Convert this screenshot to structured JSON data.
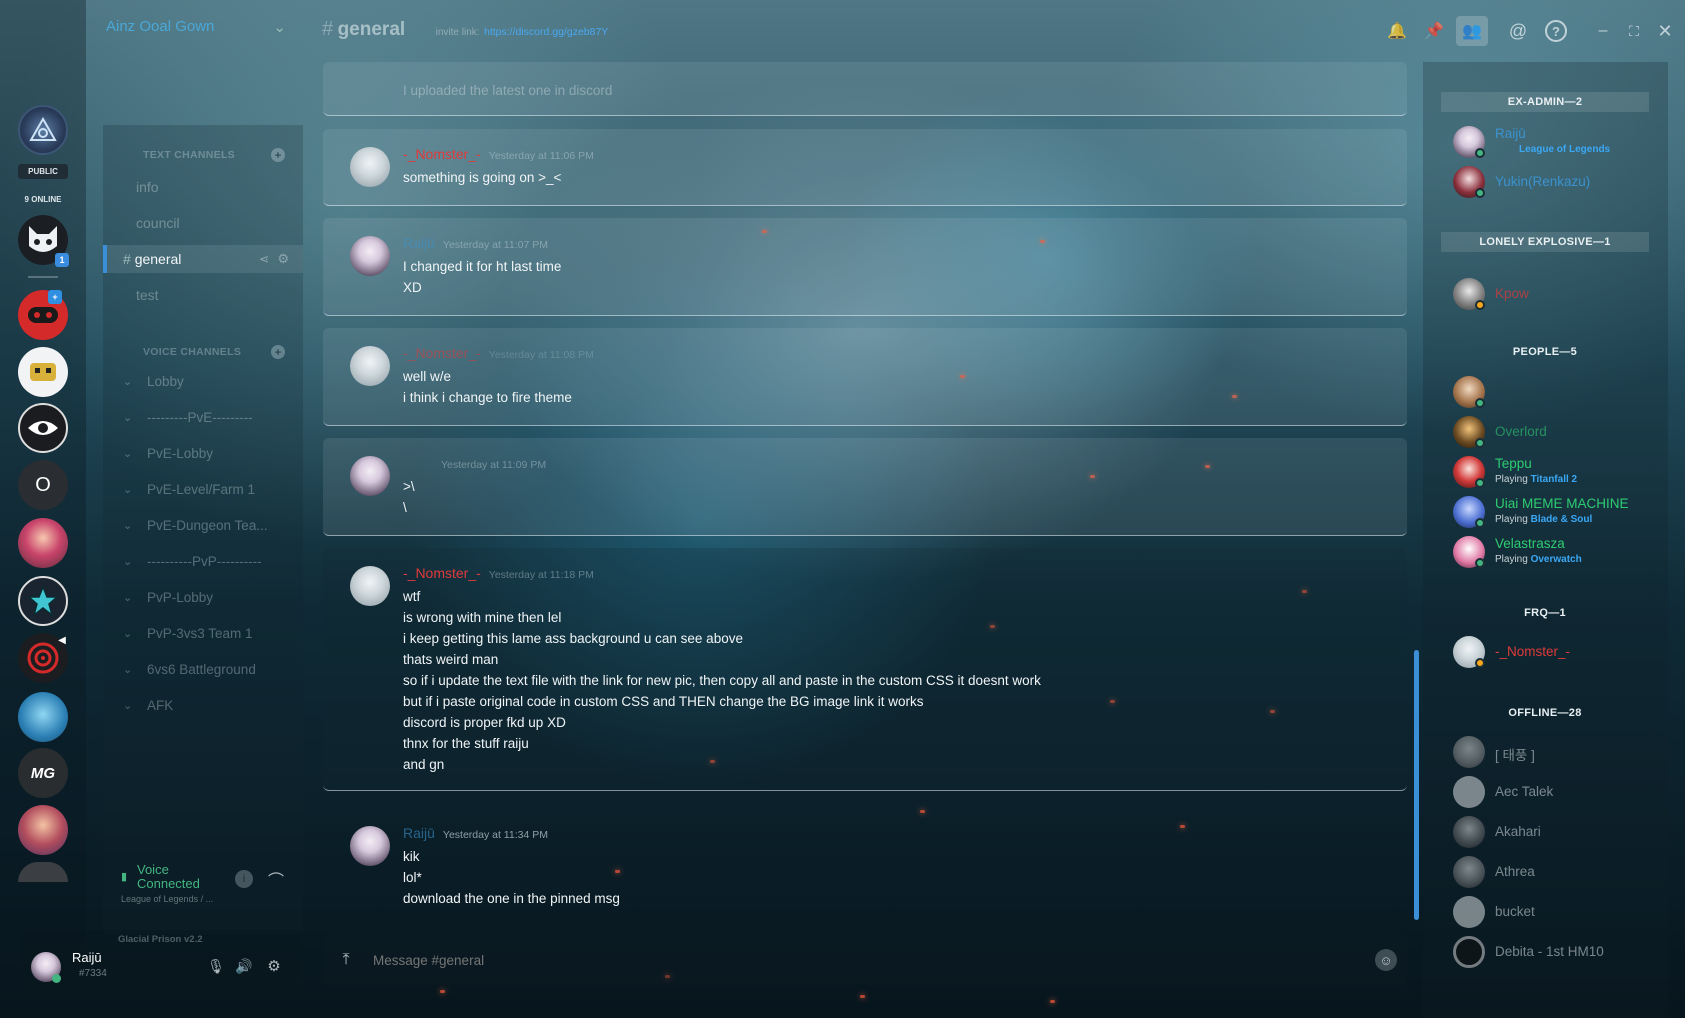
{
  "servers": {
    "public_tag": "PUBLIC",
    "online_tag": "9 ONLINE",
    "mention_count": "1",
    "o_label": "O",
    "mg_label": "MG"
  },
  "server_header": {
    "name": "Ainz Ooal Gown"
  },
  "channel_header": {
    "hash": "#",
    "name": "general",
    "invite_label": "invite link:",
    "invite_url": "https://discord.gg/gzeb87Y"
  },
  "text_channels": {
    "title": "TEXT CHANNELS",
    "items": [
      "info",
      "council",
      "general",
      "test"
    ]
  },
  "voice_channels": {
    "title": "VOICE CHANNELS",
    "items": [
      "Lobby",
      "---------PvE---------",
      "PvE-Lobby",
      "PvE-Level/Farm 1",
      "PvE-Dungeon Tea...",
      "----------PvP----------",
      "PvP-Lobby",
      "PvP-3vs3 Team 1",
      "6vs6 Battleground",
      "AFK"
    ]
  },
  "voice_status": {
    "line1": "Voice",
    "line2": "Connected",
    "sub": "League of Legends / ..."
  },
  "theme_label": "Glacial Prison v2.2",
  "user": {
    "name": "Raijū",
    "tag": "#7334"
  },
  "messages": [
    {
      "author": "",
      "time": "",
      "lines": [
        "I uploaded the latest one in discord"
      ]
    },
    {
      "author": "-_Nomster_-",
      "time": "Yesterday at 11:06 PM",
      "lines": [
        "something is going on >_<"
      ]
    },
    {
      "author": "Raijū",
      "time": "Yesterday at 11:07 PM",
      "lines": [
        "I changed it for ht last time",
        "XD"
      ]
    },
    {
      "author": "-_Nomster_-",
      "time": "Yesterday at 11:08 PM",
      "lines": [
        "well w/e",
        "i think i change to fire theme"
      ]
    },
    {
      "author": "",
      "time": "Yesterday at 11:09 PM",
      "lines": [
        ">\\",
        "\\"
      ]
    },
    {
      "author": "-_Nomster_-",
      "time": "Yesterday at 11:18 PM",
      "lines": [
        "wtf",
        "is wrong with mine then lel",
        "i keep getting this lame ass background u can see above",
        "thats weird man",
        "so if i update the text file with the link for new pic, then copy all and paste in the custom CSS it doesnt work",
        "but if i paste original code in custom CSS and THEN change the BG image link it works",
        "discord is proper fkd up XD",
        "thnx for the stuff raiju",
        "and gn"
      ]
    },
    {
      "author": "Raijū",
      "time": "Yesterday at 11:34 PM",
      "lines": [
        "kik",
        "lol*",
        "download the one in the pinned msg"
      ]
    }
  ],
  "composer": {
    "placeholder": "Message #general"
  },
  "members": {
    "groups": [
      {
        "title": "EX-ADMIN—2"
      },
      {
        "title": "LONELY EXPLOSIVE—1"
      },
      {
        "title": "PEOPLE—5"
      },
      {
        "title": "FRQ—1"
      },
      {
        "title": "OFFLINE—28"
      }
    ],
    "ex_admin": [
      {
        "name": "Raijū",
        "game": "League of Legends"
      },
      {
        "name": "Yukin(Renkazu)"
      }
    ],
    "lonely": [
      {
        "name": "Kpow"
      }
    ],
    "people": [
      {
        "name": "Overlord"
      },
      {
        "name": "Teppu",
        "playing": "Playing",
        "game": "Titanfall 2"
      },
      {
        "name": "Uiai MEME MACHINE",
        "playing": "Playing",
        "game": "Blade & Soul"
      },
      {
        "name": "Velastrasza",
        "playing": "Playing",
        "game": "Overwatch"
      }
    ],
    "frq": [
      {
        "name": "-_Nomster_-"
      }
    ],
    "offline": [
      {
        "name": "[ 태풍 ]"
      },
      {
        "name": "Aec Talek"
      },
      {
        "name": "Akahari"
      },
      {
        "name": "Athrea"
      },
      {
        "name": "bucket"
      },
      {
        "name": "Debita - 1st HM10"
      }
    ]
  },
  "colors": {
    "accent": "#3b8fd6",
    "red_name": "#e03a3a",
    "green_name": "#2ecc71",
    "blue_name": "#3b93cf"
  },
  "icons": [
    "bell-icon",
    "pin-icon",
    "members-icon",
    "mention-icon",
    "help-icon",
    "minimize-icon",
    "maximize-icon",
    "close-icon",
    "upload-icon",
    "emoji-icon",
    "mic-icon",
    "headphones-icon",
    "settings-icon",
    "disconnect-icon",
    "info-icon",
    "add-channel-icon"
  ]
}
